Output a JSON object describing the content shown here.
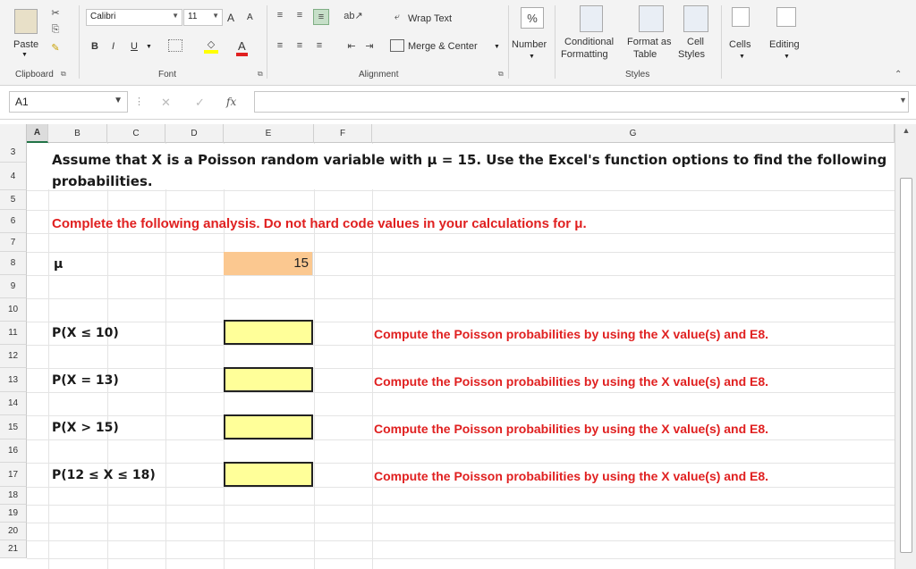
{
  "ribbon": {
    "clipboard": {
      "paste_label": "Paste",
      "group_label": "Clipboard"
    },
    "font": {
      "font_name": "Calibri",
      "font_size": "11",
      "bold": "B",
      "italic": "I",
      "underline": "U",
      "group_label": "Font",
      "grow": "A",
      "shrink": "A",
      "font_color_letter": "A"
    },
    "alignment": {
      "wrap_text": "Wrap Text",
      "merge_center": "Merge & Center",
      "group_label": "Alignment"
    },
    "number": {
      "label": "Number",
      "percent": "%"
    },
    "styles": {
      "conditional": "Conditional",
      "conditional2": "Formatting",
      "format_as": "Format as",
      "format_as2": "Table",
      "cell": "Cell",
      "cell2": "Styles",
      "group_label": "Styles"
    },
    "cells_label": "Cells",
    "editing_label": "Editing"
  },
  "formula_bar": {
    "name_box": "A1",
    "fx": "fx",
    "cancel": "✕",
    "enter": "✓"
  },
  "columns": [
    "A",
    "B",
    "C",
    "D",
    "E",
    "F",
    "G"
  ],
  "rows": [
    "3",
    "4",
    "5",
    "6",
    "7",
    "8",
    "9",
    "10",
    "11",
    "12",
    "13",
    "14",
    "15",
    "16",
    "17",
    "18",
    "19",
    "20",
    "21"
  ],
  "sheet": {
    "intro_line1": "Assume that X is a Poisson random variable with μ = 15.  Use the Excel's function options to find the following",
    "intro_line2": "probabilities.",
    "instruction": "Complete the following analysis. Do not hard code values in your calculations for μ.",
    "mu_label": "μ",
    "mu_value": "15",
    "items": [
      {
        "label": "P(X ≤ 10)",
        "hint": "Compute the Poisson probabilities by using the X value(s) and E8."
      },
      {
        "label": "P(X = 13)",
        "hint": "Compute the Poisson probabilities by using the X value(s) and E8."
      },
      {
        "label": "P(X > 15)",
        "hint": "Compute the Poisson probabilities by using the X value(s) and E8."
      },
      {
        "label": "P(12 ≤ X ≤ 18)",
        "hint": "Compute the Poisson probabilities by using the X value(s) and E8."
      }
    ]
  },
  "colors": {
    "accent": "#217346",
    "input_fill": "#ffff99",
    "mu_fill": "#fbc890",
    "instruction_red": "#e02020"
  }
}
